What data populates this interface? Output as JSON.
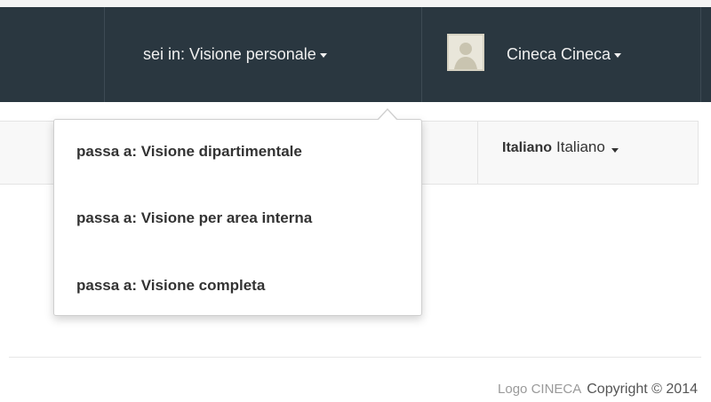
{
  "navbar": {
    "view_label": "sei in: Visione personale",
    "user_name": "Cineca Cineca",
    "background_color": "#2a3740"
  },
  "view_menu": {
    "items": [
      {
        "label": "passa a: Visione dipartimentale"
      },
      {
        "label": "passa a: Visione per area interna"
      },
      {
        "label": "passa a: Visione completa"
      }
    ]
  },
  "language": {
    "current": "Italiano",
    "selector_label": "Italiano"
  },
  "footer": {
    "logo_alt": "Logo CINECA",
    "copyright": "Copyright © 2014"
  }
}
